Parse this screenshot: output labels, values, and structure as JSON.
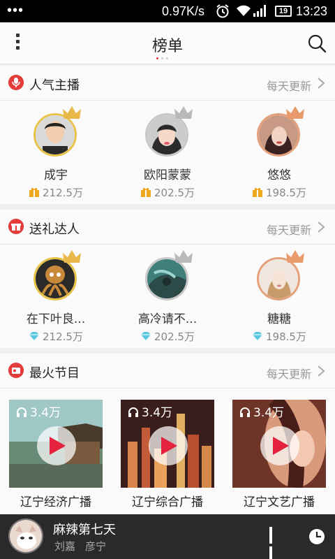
{
  "status_bar": {
    "dots": "•••",
    "net_speed": "0.97K/s",
    "battery": "19",
    "time": "13:23"
  },
  "header": {
    "title": "榜单"
  },
  "sections": [
    {
      "title": "人气主播",
      "more": "每天更新",
      "items": [
        {
          "name": "成宇",
          "value": "212.5万"
        },
        {
          "name": "欧阳蒙蒙",
          "value": "202.5万"
        },
        {
          "name": "悠悠",
          "value": "198.5万"
        }
      ]
    },
    {
      "title": "送礼达人",
      "more": "每天更新",
      "items": [
        {
          "name": "在下叶良...",
          "value": "212.5万"
        },
        {
          "name": "高冷请不...",
          "value": "202.5万"
        },
        {
          "name": "糖糖",
          "value": "198.5万"
        }
      ]
    },
    {
      "title": "最火节目",
      "more": "每天更新",
      "items": [
        {
          "name": "辽宁经济广播",
          "plays": "3.4万"
        },
        {
          "name": "辽宁综合广播",
          "plays": "3.4万"
        },
        {
          "name": "辽宁文艺广播",
          "plays": "3.4万"
        }
      ]
    }
  ],
  "player": {
    "song": "麻辣第七天",
    "artist_1": "刘嘉",
    "artist_2": "彦宁"
  },
  "colors": {
    "accent": "#e43b3b",
    "gold": "#e8c34a",
    "diamond": "#5ac8e0"
  },
  "icons": [
    "menu-icon",
    "search-icon",
    "microphone-icon",
    "gift-icon",
    "radio-icon",
    "crown-icon",
    "diamond-icon",
    "headphone-icon",
    "play-icon",
    "pause-icon",
    "clock-icon"
  ]
}
